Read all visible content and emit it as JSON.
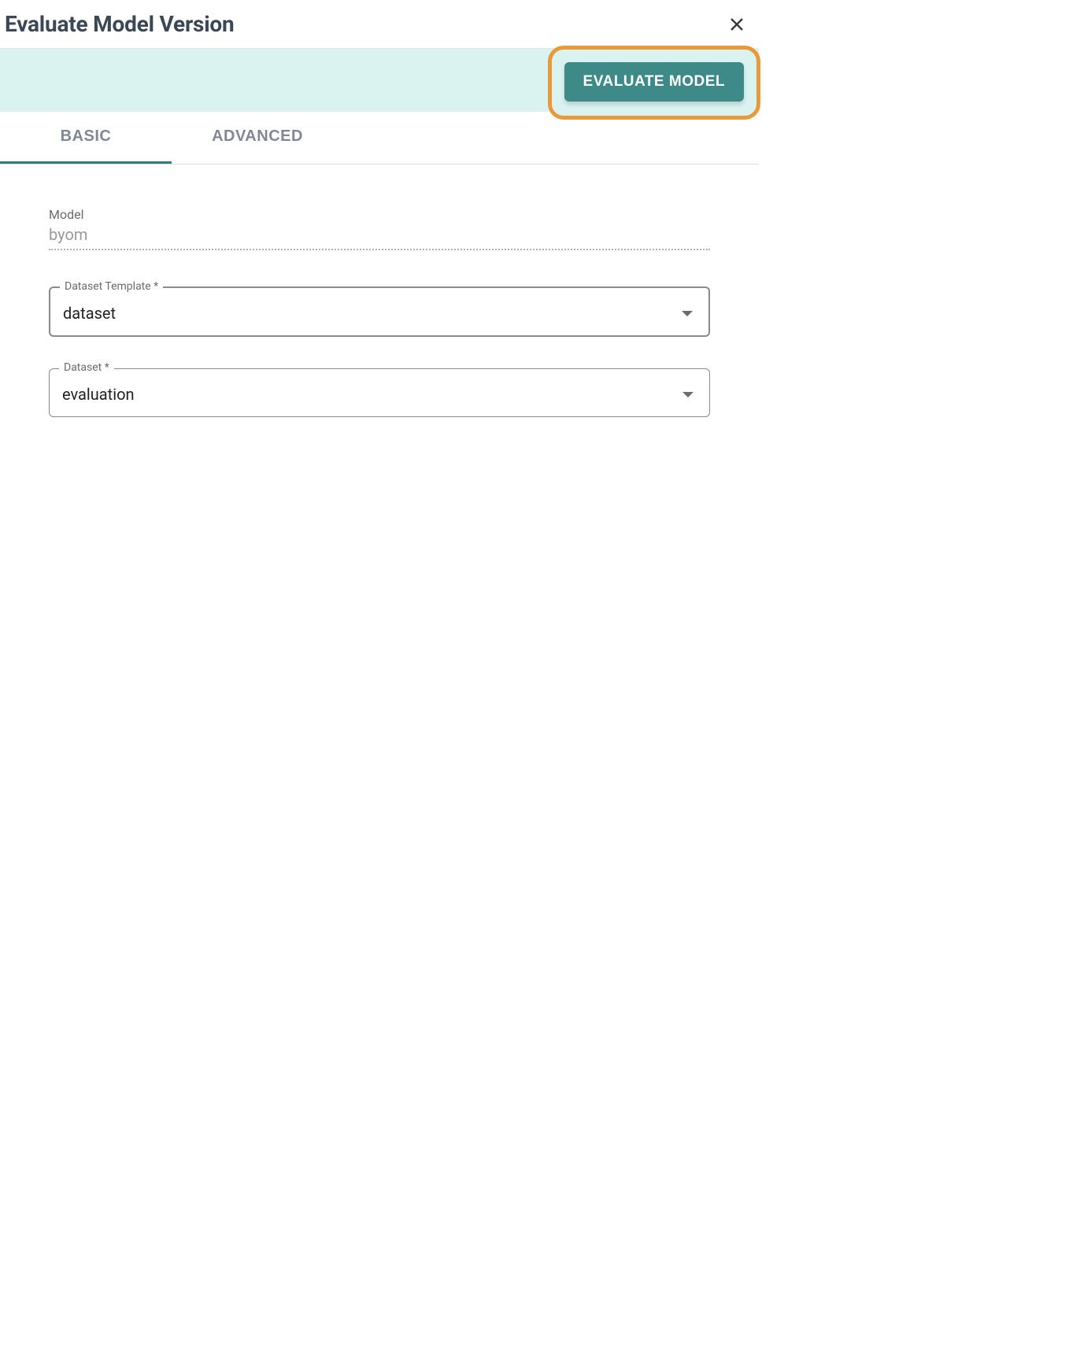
{
  "header": {
    "title": "Evaluate Model Version"
  },
  "actions": {
    "evaluate_label": "EVALUATE MODEL"
  },
  "tabs": [
    {
      "label": "BASIC",
      "active": true
    },
    {
      "label": "ADVANCED",
      "active": false
    }
  ],
  "form": {
    "model": {
      "label": "Model",
      "value": "byom"
    },
    "dataset_template": {
      "label": "Dataset Template *",
      "value": "dataset"
    },
    "dataset": {
      "label": "Dataset *",
      "value": "evaluation"
    }
  }
}
